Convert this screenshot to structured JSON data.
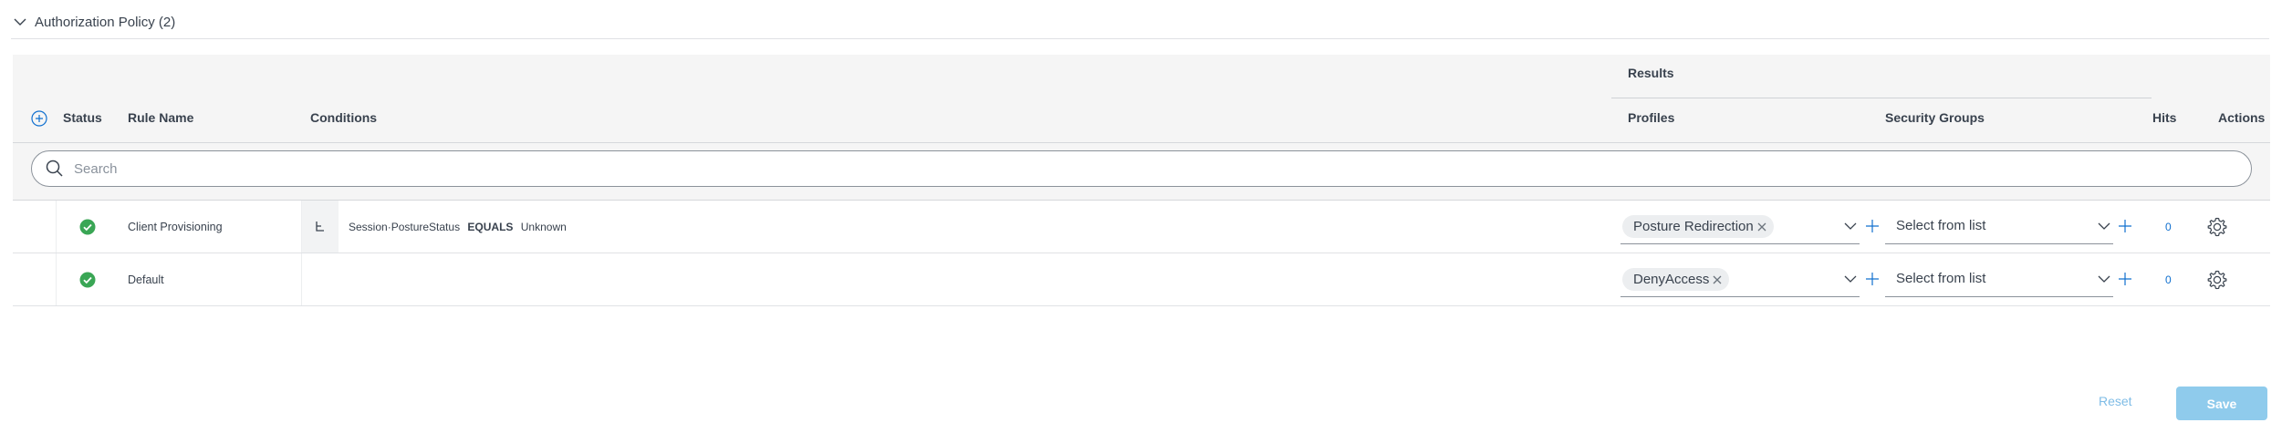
{
  "section": {
    "title": "Authorization Policy (2)"
  },
  "table": {
    "group_header": "Results",
    "columns": {
      "status": "Status",
      "rule_name": "Rule Name",
      "conditions": "Conditions",
      "profiles": "Profiles",
      "security_groups": "Security Groups",
      "hits": "Hits",
      "actions": "Actions"
    },
    "search": {
      "placeholder": "Search",
      "value": ""
    },
    "rows": [
      {
        "status": "enabled",
        "rule_name": "Client Provisioning",
        "condition": {
          "attribute": "Session·PostureStatus",
          "operator": "EQUALS",
          "value": "Unknown"
        },
        "profile": "Posture Redirection",
        "security_group": "Select from list",
        "hits": "0"
      },
      {
        "status": "enabled",
        "rule_name": "Default",
        "condition": null,
        "profile": "DenyAccess",
        "security_group": "Select from list",
        "hits": "0"
      }
    ]
  },
  "footer": {
    "reset_label": "Reset",
    "save_label": "Save"
  },
  "colors": {
    "accent": "#1170cf",
    "status_ok": "#3aa655",
    "save_bg": "#8fcbec"
  },
  "icons": {
    "collapse": "chevron-down-icon",
    "add_rule": "plus-circle-icon",
    "search": "search-icon",
    "status": "check-circle-icon",
    "condition": "condition-tree-icon",
    "remove_chip": "close-icon",
    "dropdown": "chevron-down-icon",
    "add": "plus-icon",
    "actions": "gear-icon"
  }
}
